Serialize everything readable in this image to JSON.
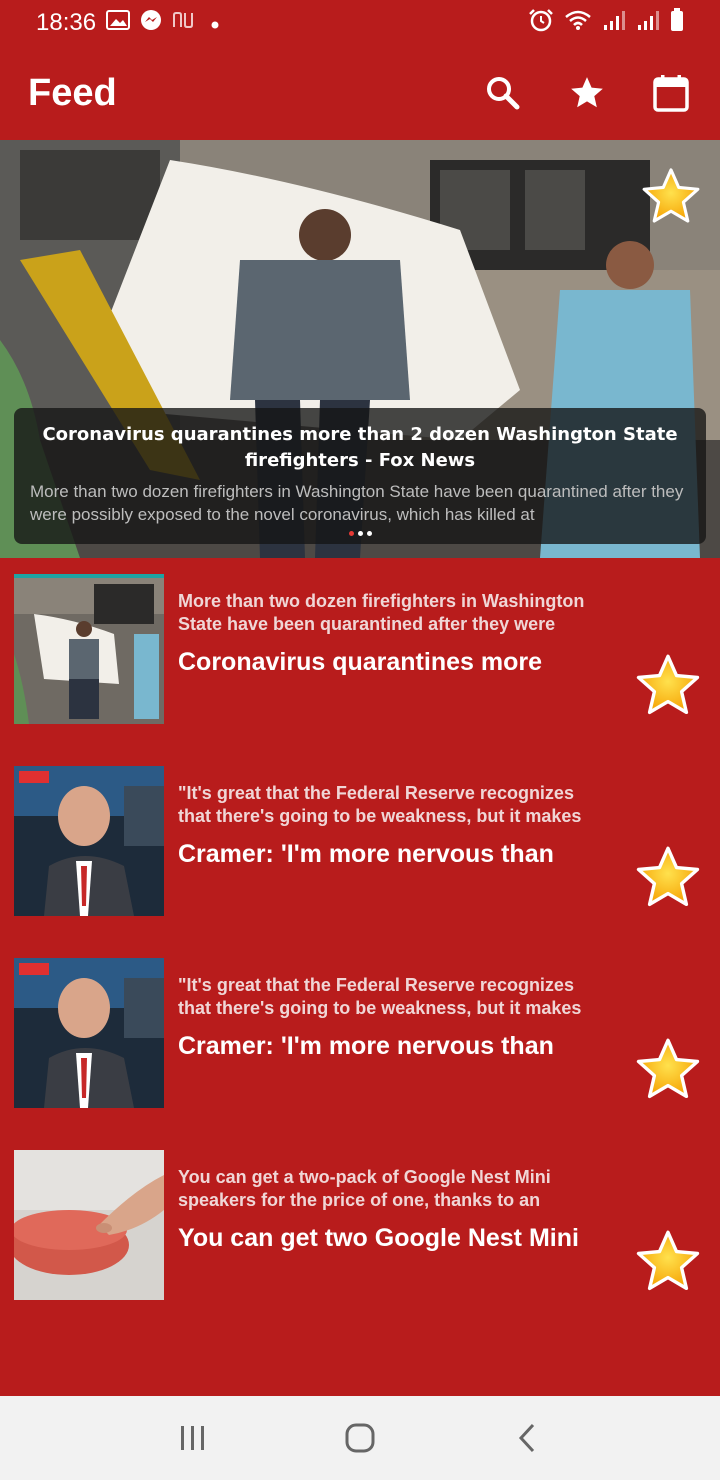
{
  "status_bar": {
    "time": "18:36",
    "icons": [
      "image-icon",
      "messenger-icon",
      "nubank-icon",
      "dot-icon",
      "alarm-icon",
      "wifi-icon",
      "signal-icon",
      "signal-icon",
      "battery-icon"
    ]
  },
  "app_bar": {
    "title": "Feed",
    "actions": [
      "search-icon",
      "star-icon",
      "calendar-icon"
    ]
  },
  "hero": {
    "title": "Coronavirus quarantines more than 2 dozen Washington State firefighters - Fox News",
    "description": "More than two dozen firefighters in Washington State have been quarantined after they were possibly exposed to the novel coronavirus, which has killed at",
    "dots": 3,
    "active_dot": 0
  },
  "feed": [
    {
      "summary": "More than two dozen firefighters in Washington State have been quarantined after they were",
      "title": "Coronavirus quarantines more",
      "thumb": "firefighters"
    },
    {
      "summary": "\"It's great that the Federal Reserve recognizes that there's going to be weakness, but it makes",
      "title": "Cramer: 'I'm more nervous than",
      "thumb": "cramer"
    },
    {
      "summary": "\"It's great that the Federal Reserve recognizes that there's going to be weakness, but it makes",
      "title": "Cramer: 'I'm more nervous than",
      "thumb": "cramer"
    },
    {
      "summary": "You can get a two-pack of Google Nest Mini speakers for the price of one, thanks to an",
      "title": "You can get two Google Nest Mini",
      "thumb": "nest"
    }
  ],
  "nav_bar": [
    "recents-icon",
    "home-icon",
    "back-icon"
  ],
  "colors": {
    "background": "#b81c1c",
    "nav_background": "#f2f2f2",
    "star_fill": "#f5b800"
  }
}
